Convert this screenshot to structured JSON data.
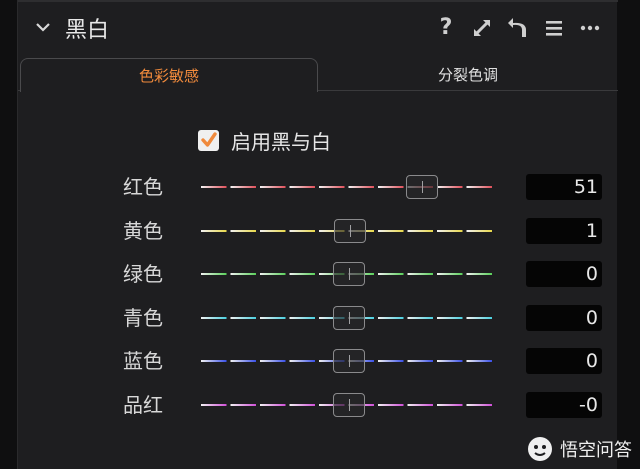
{
  "header": {
    "title": "黑白",
    "icons": [
      "chevron-down-icon",
      "help-icon",
      "expand-icon",
      "reset-icon",
      "menu-icon",
      "more-icon"
    ],
    "help_glyph": "?"
  },
  "tabs": [
    {
      "label": "色彩敏感",
      "active": true
    },
    {
      "label": "分裂色调",
      "active": false
    }
  ],
  "enable": {
    "label": "启用黑与白",
    "checked": true
  },
  "sliders": [
    {
      "label": "红色",
      "value": "51",
      "level": 0.75,
      "color": "#e0505a"
    },
    {
      "label": "黄色",
      "value": "1",
      "level": 0.505,
      "color": "#e8d84a"
    },
    {
      "label": "绿色",
      "value": "0",
      "level": 0.5,
      "color": "#5ad05a"
    },
    {
      "label": "青色",
      "value": "0",
      "level": 0.5,
      "color": "#4ad0e0"
    },
    {
      "label": "蓝色",
      "value": "0",
      "level": 0.5,
      "color": "#3a50e8"
    },
    {
      "label": "品红",
      "value": "-0",
      "level": 0.5,
      "color": "#d050d8"
    }
  ],
  "colors": {
    "accent": "#f08a3c",
    "panel": "#1e1e20"
  },
  "watermark": {
    "text": "悟空问答"
  }
}
